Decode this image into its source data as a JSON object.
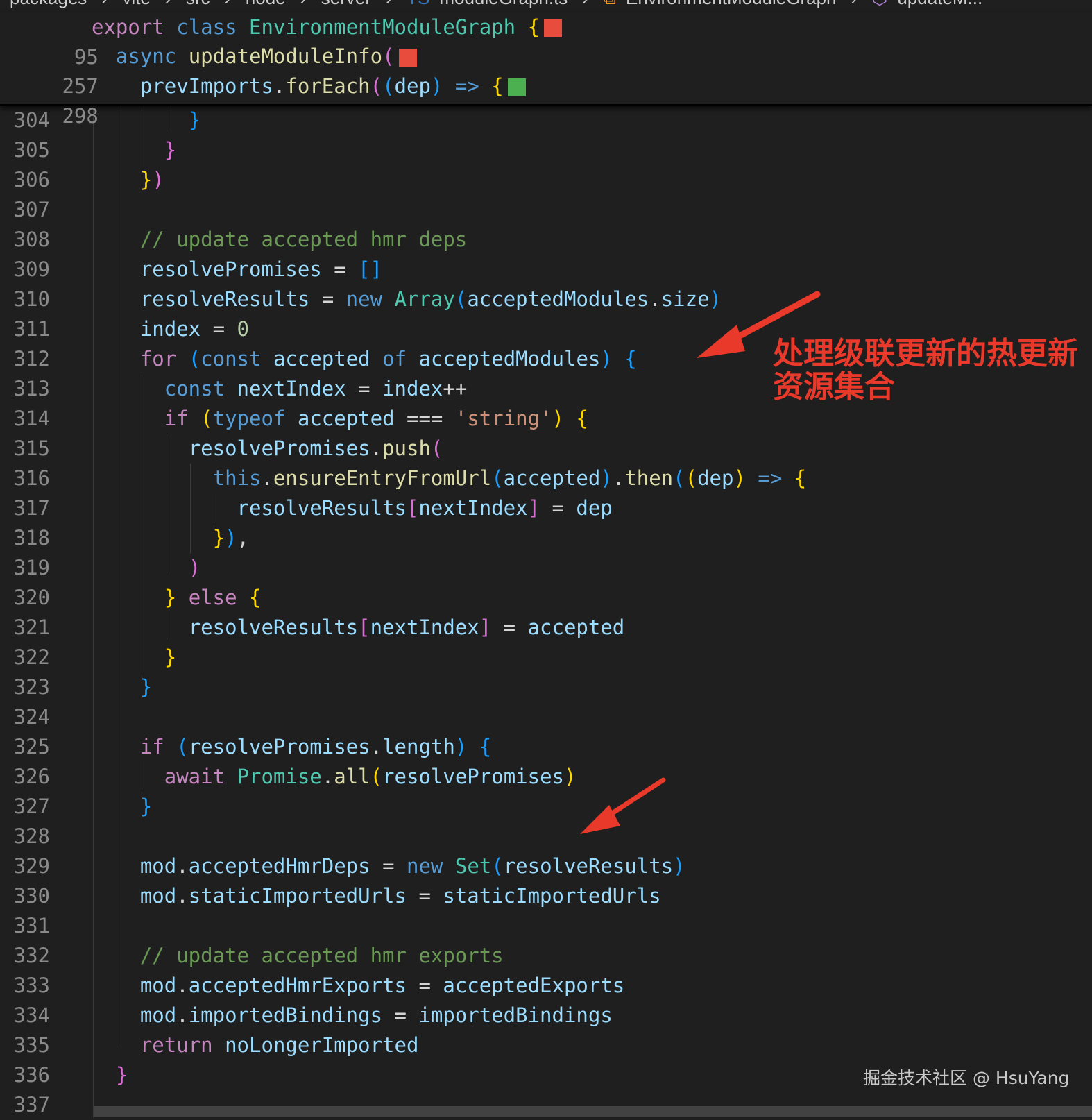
{
  "breadcrumb": {
    "items": [
      "packages",
      "vite",
      "src",
      "node",
      "server",
      "moduleGraph.ts",
      "EnvironmentModuleGraph",
      "updateM..."
    ]
  },
  "sticky_lines": [
    {
      "num": "95",
      "text": "export class EnvironmentModuleGraph {"
    },
    {
      "num": "257",
      "text": "async updateModuleInfo("
    },
    {
      "num": "298",
      "text": "prevImports.forEach((dep) => {"
    }
  ],
  "lines": [
    {
      "num": "304",
      "text": "}"
    },
    {
      "num": "305",
      "text": "}"
    },
    {
      "num": "306",
      "text": "})"
    },
    {
      "num": "307",
      "text": ""
    },
    {
      "num": "308",
      "text": "// update accepted hmr deps"
    },
    {
      "num": "309",
      "text": "resolvePromises = []"
    },
    {
      "num": "310",
      "text": "resolveResults = new Array(acceptedModules.size)"
    },
    {
      "num": "311",
      "text": "index = 0"
    },
    {
      "num": "312",
      "text": "for (const accepted of acceptedModules) {"
    },
    {
      "num": "313",
      "text": "const nextIndex = index++"
    },
    {
      "num": "314",
      "text": "if (typeof accepted === 'string') {"
    },
    {
      "num": "315",
      "text": "resolvePromises.push("
    },
    {
      "num": "316",
      "text": "this.ensureEntryFromUrl(accepted).then((dep) => {"
    },
    {
      "num": "317",
      "text": "resolveResults[nextIndex] = dep"
    },
    {
      "num": "318",
      "text": "}),"
    },
    {
      "num": "319",
      "text": ")"
    },
    {
      "num": "320",
      "text": "} else {"
    },
    {
      "num": "321",
      "text": "resolveResults[nextIndex] = accepted"
    },
    {
      "num": "322",
      "text": "}"
    },
    {
      "num": "323",
      "text": "}"
    },
    {
      "num": "324",
      "text": ""
    },
    {
      "num": "325",
      "text": "if (resolvePromises.length) {"
    },
    {
      "num": "326",
      "text": "await Promise.all(resolvePromises)"
    },
    {
      "num": "327",
      "text": "}"
    },
    {
      "num": "328",
      "text": ""
    },
    {
      "num": "329",
      "text": "mod.acceptedHmrDeps = new Set(resolveResults)"
    },
    {
      "num": "330",
      "text": "mod.staticImportedUrls = staticImportedUrls"
    },
    {
      "num": "331",
      "text": ""
    },
    {
      "num": "332",
      "text": "// update accepted hmr exports"
    },
    {
      "num": "333",
      "text": "mod.acceptedHmrExports = acceptedExports"
    },
    {
      "num": "334",
      "text": "mod.importedBindings = importedBindings"
    },
    {
      "num": "335",
      "text": "return noLongerImported"
    },
    {
      "num": "336",
      "text": "}"
    },
    {
      "num": "337",
      "text": ""
    }
  ],
  "annotation": {
    "text_line1": "处理级联更新的热更新",
    "text_line2": "资源集合",
    "color": "#e8392a"
  },
  "watermark": "掘金技术社区 @ HsuYang",
  "colors": {
    "background": "#1f1f1f",
    "keyword": "#569cd6",
    "control": "#c586c0",
    "function": "#dcdcaa",
    "class": "#4ec9b0",
    "variable": "#9cdcfe",
    "string": "#ce9178",
    "comment": "#6a9955",
    "marker_red": "#e74c3c",
    "marker_green": "#4caf50"
  }
}
